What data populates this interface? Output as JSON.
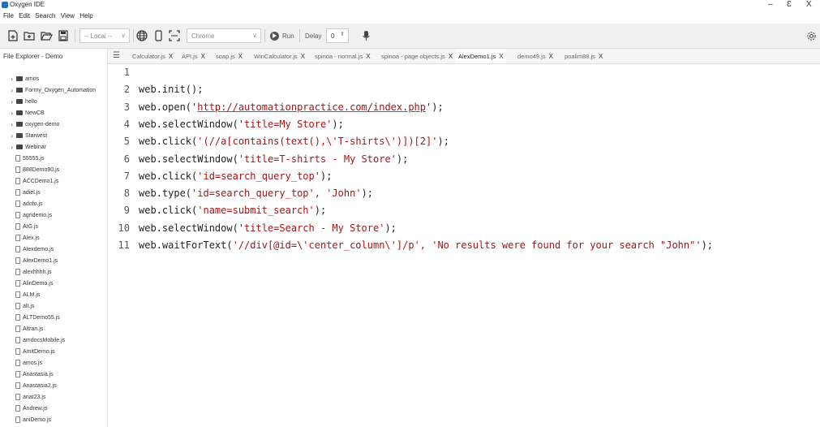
{
  "window": {
    "title": "Oxygen IDE",
    "controls": [
      "–",
      "Ɛ",
      "X"
    ]
  },
  "menu": [
    "File",
    "Edit",
    "Search",
    "View",
    "Help"
  ],
  "toolbar": {
    "mode": "-- Local --",
    "browser": "Chrome",
    "run_label": "Run",
    "delay_label": "Delay",
    "delay_value": "0"
  },
  "sidebar": {
    "title": "File Explorer - Demo",
    "folders": [
      "amos",
      "Formy_Oxygen_Automation",
      "hello",
      "NewCB",
      "oxygen-demo",
      "Starwest",
      "Webinar"
    ],
    "files": [
      "55555.js",
      "888Demo90.js",
      "ACCDemo1.js",
      "adiel.js",
      "adofo.js",
      "agridemo.js",
      "AIG.js",
      "Alex.js",
      "Alexdemo.js",
      "AlexDemo1.js",
      "alexhhhh.js",
      "AlinDemo.js",
      "ALM.js",
      "alt.js",
      "ALTDemo55.js",
      "Altran.js",
      "amdocsMobile.js",
      "AmitDemo.js",
      "amos.js",
      "Anastasia.js",
      "Anastasia2.js",
      "anat23.js",
      "Andrew.js",
      "aniDemo.js"
    ]
  },
  "tabs": [
    {
      "label": "Calculator.js",
      "active": false
    },
    {
      "label": "API.js",
      "active": false
    },
    {
      "label": "soap.js",
      "active": false
    },
    {
      "label": "WinCalculator.js",
      "active": false
    },
    {
      "label": "spinoa - normal.js",
      "active": false
    },
    {
      "label": "spinoa - page objects.js",
      "active": false
    },
    {
      "label": "AlexDemo1.js",
      "active": true
    },
    {
      "label": "demo49.js",
      "active": false
    },
    {
      "label": "poalim88.js",
      "active": false
    }
  ],
  "tab_close": "X",
  "editor": {
    "lines": [
      {
        "n": "1",
        "pre": "",
        "str": "",
        "post": ""
      },
      {
        "n": "2",
        "pre": "web.init();",
        "str": "",
        "post": ""
      },
      {
        "n": "3",
        "pre": "web.open('",
        "str": "http://automationpractice.com/index.php",
        "post": "');"
      },
      {
        "n": "4",
        "pre": "web.selectWindow(",
        "str": "'title=My Store'",
        "post": ");"
      },
      {
        "n": "5",
        "pre": "web.click(",
        "str": "'(//a[contains(text(),\\'T-shirts\\')])[2]'",
        "post": ");"
      },
      {
        "n": "6",
        "pre": "web.selectWindow(",
        "str": "'title=T-shirts - My Store'",
        "post": ");"
      },
      {
        "n": "7",
        "pre": "web.click(",
        "str": "'id=search_query_top'",
        "post": ");"
      },
      {
        "n": "8",
        "pre": "web.type(",
        "str": "'id=search_query_top', 'John'",
        "post": ");"
      },
      {
        "n": "9",
        "pre": "web.click(",
        "str": "'name=submit_search'",
        "post": ");"
      },
      {
        "n": "10",
        "pre": "web.selectWindow(",
        "str": "'title=Search - My Store'",
        "post": ");"
      },
      {
        "n": "11",
        "pre": "web.waitForText(",
        "str": "'//div[@id=\\'center_column\\']/p', 'No results were found for your search \"John\"'",
        "post": ");"
      }
    ]
  }
}
